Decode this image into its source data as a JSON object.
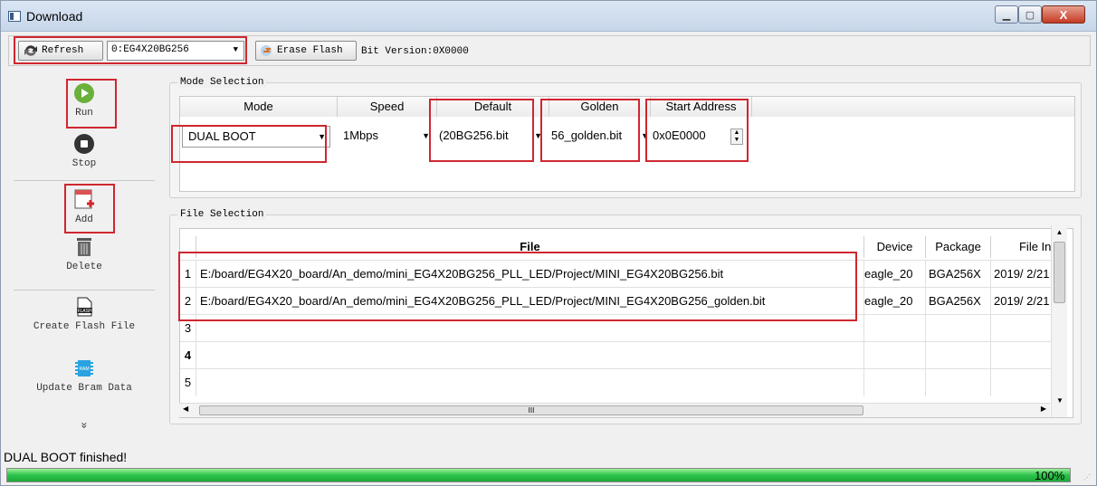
{
  "window": {
    "title": "Download",
    "min_glyph": "▁",
    "max_glyph": "▢",
    "close_glyph": "X"
  },
  "toolbar": {
    "refresh_label": "Refresh",
    "device_selected": "0:EG4X20BG256",
    "erase_label": "Erase Flash",
    "bit_version": "Bit Version:0X0000"
  },
  "sidebar": {
    "run_label": "Run",
    "stop_label": "Stop",
    "add_label": "Add",
    "delete_label": "Delete",
    "create_flash_label": "Create Flash File",
    "update_bram_label": "Update Bram Data",
    "more_glyph": "»",
    "flash_icon_text": "FLASH",
    "ram_icon_text": "RAM"
  },
  "mode_selection": {
    "title": "Mode Selection",
    "headers": [
      "Mode",
      "Speed",
      "Default",
      "Golden",
      "Start Address"
    ],
    "mode": "DUAL BOOT",
    "speed": "1Mbps",
    "default": "(20BG256.bit",
    "golden": "56_golden.bit",
    "start_address": "0x0E0000"
  },
  "file_selection": {
    "title": "File Selection",
    "headers": [
      "File",
      "Device",
      "Package",
      "File Inf"
    ],
    "rows": [
      {
        "num": "1",
        "file": "E:/board/EG4X20_board/An_demo/mini_EG4X20BG256_PLL_LED/Project/MINI_EG4X20BG256.bit",
        "device": "eagle_20",
        "package": "BGA256X",
        "info": "2019/ 2/21"
      },
      {
        "num": "2",
        "file": "E:/board/EG4X20_board/An_demo/mini_EG4X20BG256_PLL_LED/Project/MINI_EG4X20BG256_golden.bit",
        "device": "eagle_20",
        "package": "BGA256X",
        "info": "2019/ 2/21"
      },
      {
        "num": "3",
        "file": "",
        "device": "",
        "package": "",
        "info": ""
      },
      {
        "num": "4",
        "file": "",
        "device": "",
        "package": "",
        "info": ""
      },
      {
        "num": "5",
        "file": "",
        "device": "",
        "package": "",
        "info": ""
      }
    ],
    "hscroll_glyph": "III"
  },
  "status": {
    "message": "DUAL BOOT finished!",
    "progress_percent": 100,
    "progress_label": "100%"
  },
  "colors": {
    "highlight": "#d0262f",
    "progress": "#2bc34a"
  }
}
